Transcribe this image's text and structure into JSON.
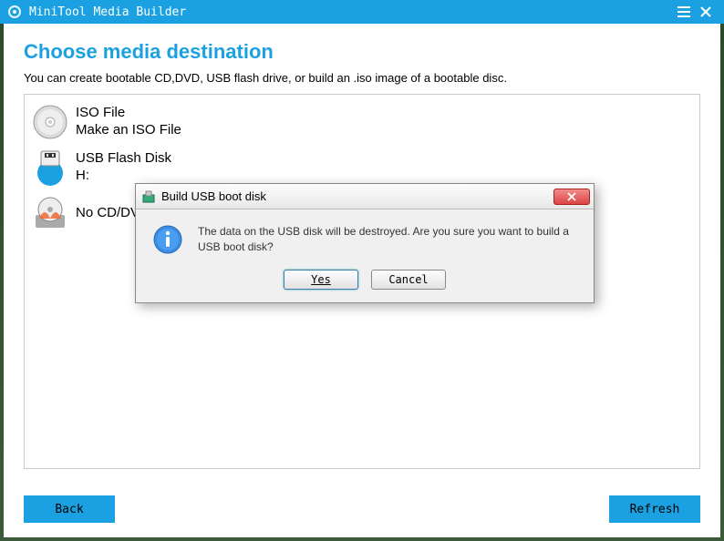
{
  "titlebar": {
    "app_name": "MiniTool Media Builder"
  },
  "page": {
    "heading": "Choose media destination",
    "subheading": "You can create bootable CD,DVD, USB flash drive, or build an .iso image of a bootable disc."
  },
  "options": [
    {
      "title": "ISO File",
      "subtitle": "Make an ISO File",
      "icon": "disc-iso"
    },
    {
      "title": "USB Flash Disk",
      "subtitle": "H:",
      "icon": "usb-disk"
    },
    {
      "title": "No CD/DVD burner",
      "subtitle": "",
      "icon": "cd-burner"
    }
  ],
  "footer": {
    "back": "Back",
    "refresh": "Refresh"
  },
  "dialog": {
    "title": "Build USB boot disk",
    "message": "The data on the USB disk will be destroyed. Are you sure you want to build a USB boot disk?",
    "yes": "Yes",
    "cancel": "Cancel"
  }
}
